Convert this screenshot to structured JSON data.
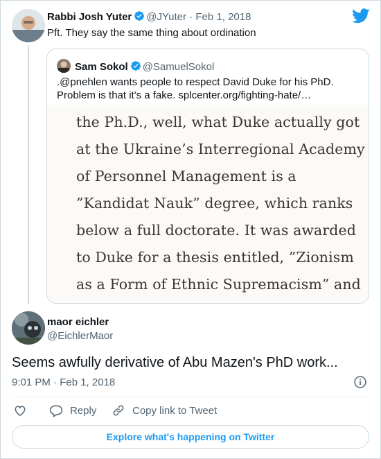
{
  "parent_tweet": {
    "display_name": "Rabbi Josh Yuter",
    "handle": "@JYuter",
    "separator": "·",
    "date": "Feb 1, 2018",
    "text": "Pft. They say the same thing about ordination"
  },
  "quoted_tweet": {
    "display_name": "Sam Sokol",
    "handle": "@SamuelSokol",
    "text": ".@pnehlen wants people to respect David Duke for his PhD. Problem is that it's a fake. splcenter.org/fighting-hate/…",
    "image_lines": [
      "the Ph.D., well, what Duke actually got",
      "at the Ukraine’s Interregional Academy",
      "of Personnel Management is a",
      "”Kandidat Nauk” degree, which ranks",
      "below a full doctorate. It was awarded",
      "to Duke for a thesis entitled, ”Zionism",
      "as a Form of Ethnic Supremacism” and"
    ]
  },
  "main_tweet": {
    "display_name": "maor eichler",
    "handle": "@EichlerMaor",
    "text": "Seems awfully derivative of Abu Mazen's PhD work...",
    "timestamp": "9:01 PM · Feb 1, 2018"
  },
  "actions": {
    "like_icon": "heart-icon",
    "reply_label": "Reply",
    "copy_link_label": "Copy link to Tweet"
  },
  "explore_label": "Explore what's happening on Twitter",
  "colors": {
    "twitter_blue": "#1d9bf0",
    "text_primary": "#0f1419",
    "text_secondary": "#536471",
    "border": "#cfd9de"
  }
}
